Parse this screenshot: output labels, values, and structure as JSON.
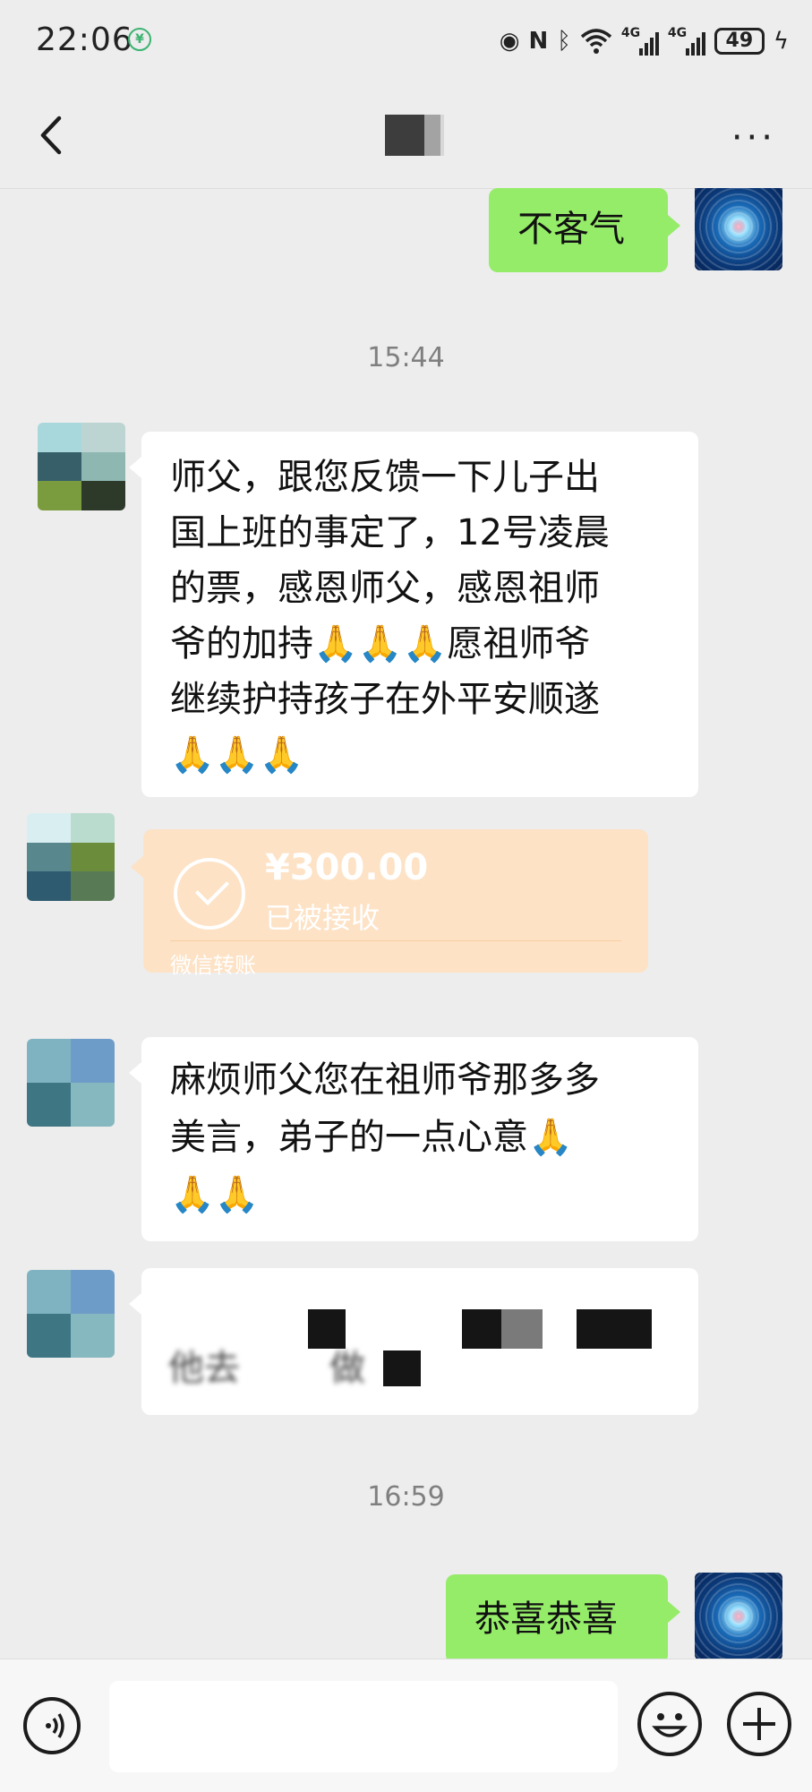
{
  "status_bar": {
    "time": "22:06",
    "app_icon": "coin-app-icon",
    "network_label_1": "4G",
    "network_label_2": "4G",
    "battery": "49",
    "icons": [
      "eye-icon",
      "nfc-icon",
      "bluetooth-icon",
      "wifi-icon",
      "signal-icon",
      "signal-icon",
      "battery-icon",
      "charging-icon"
    ]
  },
  "nav": {
    "back_icon": "chevron-left-icon",
    "more_icon": "more-icon"
  },
  "messages": [
    {
      "side": "right",
      "text": "不客气"
    },
    {
      "type": "time",
      "text": "15:44"
    },
    {
      "side": "left",
      "lines": [
        "师父，跟您反馈一下儿子出",
        "国上班的事定了，12号凌晨",
        "的票，感恩师父，感恩祖师",
        "爷的加持🙏🙏🙏愿祖师爷",
        "继续护持孩子在外平安顺遂",
        "🙏🙏🙏"
      ]
    },
    {
      "side": "left",
      "type": "transfer",
      "amount": "¥300.00",
      "status": "已被接收",
      "source": "微信转账"
    },
    {
      "side": "left",
      "lines": [
        "麻烦师父您在祖师爷那多多",
        "美言，弟子的一点心意🙏",
        "🙏🙏"
      ]
    },
    {
      "side": "left",
      "lines": [
        "他去",
        "做"
      ]
    },
    {
      "type": "time",
      "text": "16:59"
    },
    {
      "side": "right",
      "text": "恭喜恭喜"
    }
  ],
  "input_bar": {
    "voice_icon": "voice-icon",
    "emoji_icon": "emoji-icon",
    "plus_icon": "plus-icon",
    "placeholder": ""
  },
  "colors": {
    "background": "#ededed",
    "sent_bubble": "#95ec69",
    "received_bubble": "#ffffff",
    "transfer_card": "#fde2c5"
  }
}
